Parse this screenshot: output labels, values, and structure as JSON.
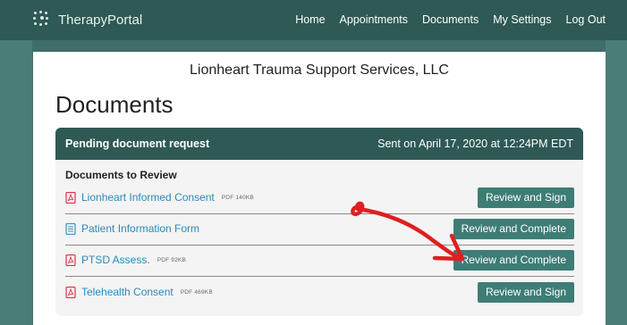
{
  "app": {
    "name": "TherapyPortal"
  },
  "nav": {
    "items": [
      {
        "label": "Home"
      },
      {
        "label": "Appointments"
      },
      {
        "label": "Documents"
      },
      {
        "label": "My Settings"
      },
      {
        "label": "Log Out"
      }
    ]
  },
  "company": {
    "name": "Lionheart Trauma Support Services, LLC"
  },
  "page": {
    "title": "Documents"
  },
  "panel": {
    "title": "Pending document request",
    "sent": "Sent on April 17, 2020 at 12:24PM EDT",
    "section_label": "Documents to Review",
    "documents": [
      {
        "name": "Lionheart Informed Consent",
        "meta": "PDF 140KB",
        "icon": "pdf-icon",
        "action": "Review and Sign"
      },
      {
        "name": "Patient Information Form",
        "meta": "",
        "icon": "form-icon",
        "action": "Review and Complete"
      },
      {
        "name": "PTSD Assess.",
        "meta": "PDF 92KB",
        "icon": "pdf-icon",
        "action": "Review and Complete"
      },
      {
        "name": "Telehealth Consent",
        "meta": "PDF 469KB",
        "icon": "pdf-icon",
        "action": "Review and Sign"
      }
    ]
  },
  "colors": {
    "header": "#2e5954",
    "button": "#3e7d75",
    "link": "#2a8ab8",
    "pdf_icon": "#d9324a",
    "form_icon": "#3b8fc4",
    "annotation": "#e01f1f"
  }
}
